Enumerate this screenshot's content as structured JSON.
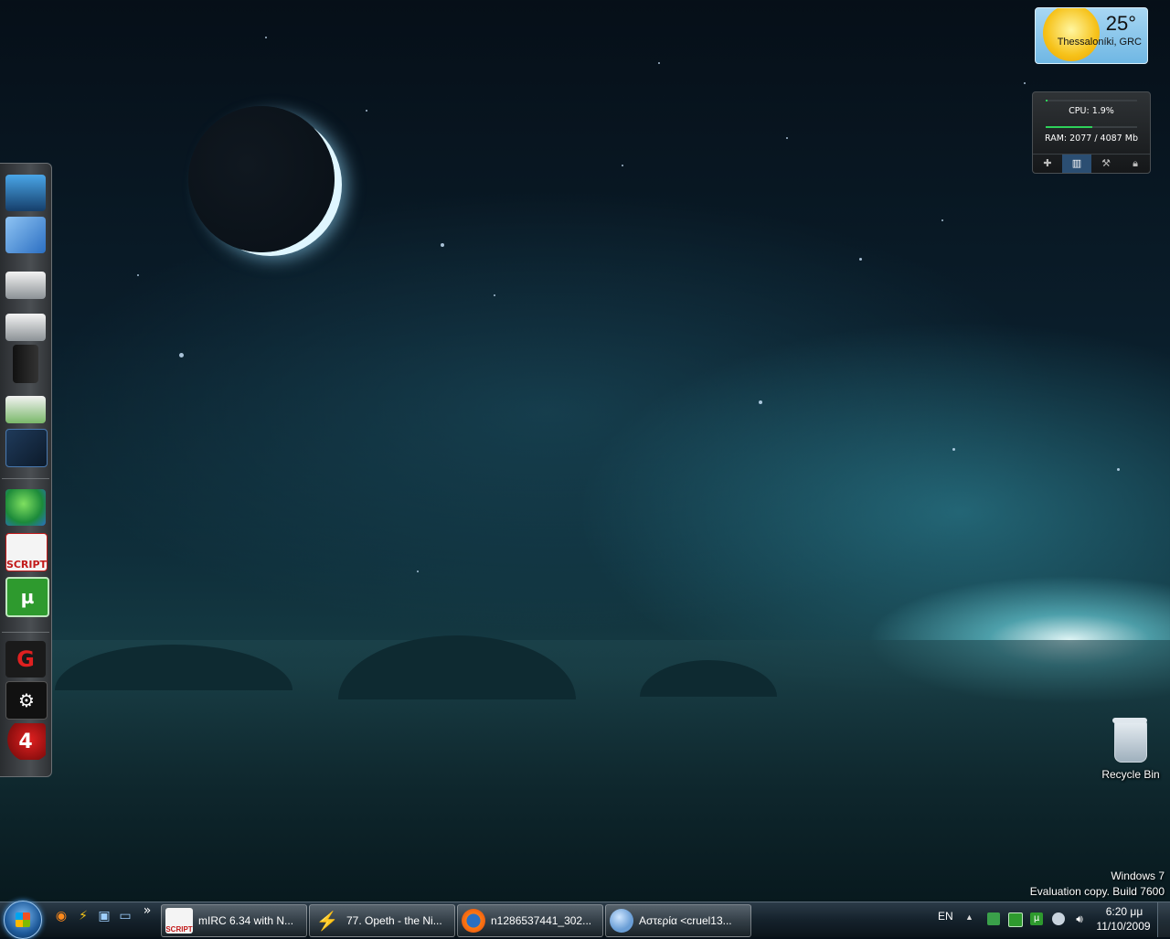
{
  "weather": {
    "temperature": "25°",
    "location": "Thessaloníki, GRC"
  },
  "cpu_meter": {
    "cpu_label": "CPU: 1.9%",
    "ram_label": "RAM: 2077 / 4087 Mb",
    "cpu_fraction": 0.019,
    "ram_fraction": 0.508
  },
  "dock": {
    "items": [
      "computer-icon",
      "documents-icon",
      "drive-icon",
      "drive-icon",
      "pc-tower-icon",
      "network-drive-icon",
      "media-folder-icon",
      "messenger-icon",
      "mirc-icon",
      "utorrent-icon",
      "garena-icon",
      "steam-icon",
      "left4dead-icon"
    ]
  },
  "desktop": {
    "recycle_bin_label": "Recycle Bin"
  },
  "watermark": {
    "line1": "Windows 7",
    "line2": "Evaluation copy. Build 7600"
  },
  "taskbar": {
    "tasks": [
      {
        "label": "mIRC 6.34 with N...",
        "icon": "mirc-icon"
      },
      {
        "label": "77. Opeth - the Ni...",
        "icon": "winamp-icon"
      },
      {
        "label": "n1286537441_302...",
        "icon": "firefox-icon"
      },
      {
        "label": "Αστερία <cruel13...",
        "icon": "messenger-icon"
      }
    ],
    "overflow": "»",
    "language": "EN",
    "time": "6:20 μμ",
    "date": "11/10/2009",
    "tray_arrow": "▲"
  }
}
